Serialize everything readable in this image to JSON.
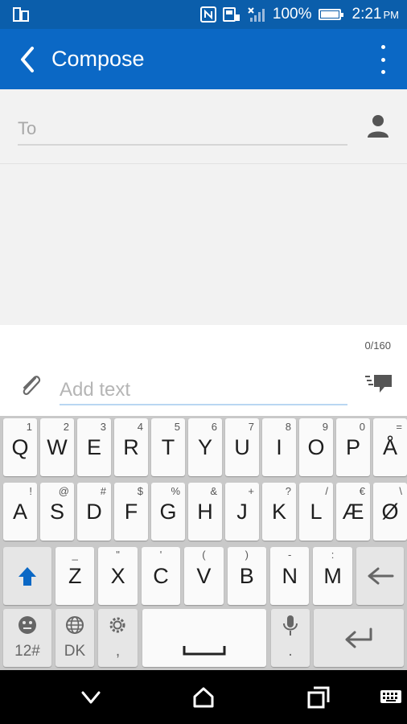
{
  "status_bar": {
    "battery_text": "100%",
    "battery_level": 1.0,
    "time": "2:21",
    "time_suffix": "PM"
  },
  "app_bar": {
    "title": "Compose"
  },
  "to_field": {
    "placeholder": "To"
  },
  "compose": {
    "char_count": "0/160",
    "placeholder": "Add text"
  },
  "keyboard": {
    "row1": [
      {
        "main": "Q",
        "alt": "1"
      },
      {
        "main": "W",
        "alt": "2"
      },
      {
        "main": "E",
        "alt": "3"
      },
      {
        "main": "R",
        "alt": "4"
      },
      {
        "main": "T",
        "alt": "5"
      },
      {
        "main": "Y",
        "alt": "6"
      },
      {
        "main": "U",
        "alt": "7"
      },
      {
        "main": "I",
        "alt": "8"
      },
      {
        "main": "O",
        "alt": "9"
      },
      {
        "main": "P",
        "alt": "0"
      },
      {
        "main": "Å",
        "alt": "="
      }
    ],
    "row2": [
      {
        "main": "A",
        "alt": "!"
      },
      {
        "main": "S",
        "alt": "@"
      },
      {
        "main": "D",
        "alt": "#"
      },
      {
        "main": "F",
        "alt": "$"
      },
      {
        "main": "G",
        "alt": "%"
      },
      {
        "main": "H",
        "alt": "&"
      },
      {
        "main": "J",
        "alt": "+"
      },
      {
        "main": "K",
        "alt": "?"
      },
      {
        "main": "L",
        "alt": "/"
      },
      {
        "main": "Æ",
        "alt": "€"
      },
      {
        "main": "Ø",
        "alt": "\\"
      }
    ],
    "row3": [
      {
        "main": "Z",
        "alt": "_"
      },
      {
        "main": "X",
        "alt": "\""
      },
      {
        "main": "C",
        "alt": "'"
      },
      {
        "main": "V",
        "alt": "("
      },
      {
        "main": "B",
        "alt": ")"
      },
      {
        "main": "N",
        "alt": "-"
      },
      {
        "main": "M",
        "alt": ":"
      }
    ],
    "symbols_label": "12#",
    "language_label": "DK",
    "settings_sub": ",",
    "mic_sub": ".",
    "icons": {
      "shift": "shift-up-arrow-icon",
      "backspace": "backspace-arrow-icon",
      "emoji": "emoji-icon",
      "language": "globe-icon",
      "settings": "settings-gear-icon",
      "space": "space-bar-icon",
      "mic": "microphone-icon",
      "enter": "enter-return-icon"
    },
    "accent_color": "#0b68c5"
  },
  "colors": {
    "status_bar": "#0b5eab",
    "app_bar": "#0b68c5",
    "background": "#f2f2f2",
    "keyboard": "#c9c9c9"
  }
}
